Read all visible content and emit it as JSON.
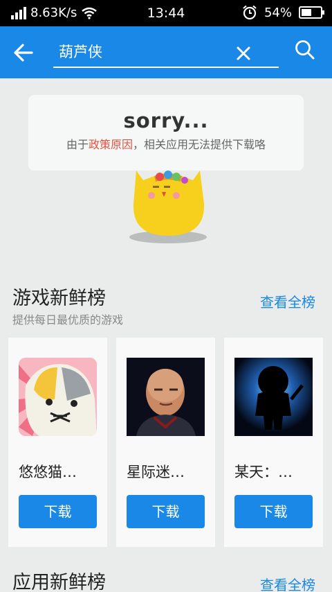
{
  "status_bar": {
    "network_speed": "8.63K/s",
    "time": "13:44",
    "battery": "54%",
    "battery_level": 0.54,
    "icons": [
      "signal-icon",
      "wifi-icon",
      "alarm-icon",
      "battery-icon"
    ]
  },
  "app_bar": {
    "search_value": "葫芦侠",
    "accent_color": "#1a88e6",
    "icons": [
      "back-arrow-icon",
      "clear-icon",
      "search-icon"
    ]
  },
  "notice": {
    "title": "sorry...",
    "message_prefix": "由于",
    "message_highlight": "政策原因",
    "message_suffix": "，相关应用无法提供下载咯",
    "highlight_color": "#e2533f"
  },
  "games_section": {
    "title": "游戏新鲜榜",
    "subtitle": "提供每日最优质的游戏",
    "view_all": "查看全榜",
    "apps": [
      {
        "name": "悠悠猫…",
        "button": "下载",
        "icon": "cat-game-icon"
      },
      {
        "name": "星际迷…",
        "button": "下载",
        "icon": "starship-game-icon"
      },
      {
        "name": "某天：…",
        "button": "下载",
        "icon": "silhouette-game-icon"
      }
    ]
  },
  "apps_section": {
    "title": "应用新鲜榜",
    "view_all": "查看全榜"
  }
}
